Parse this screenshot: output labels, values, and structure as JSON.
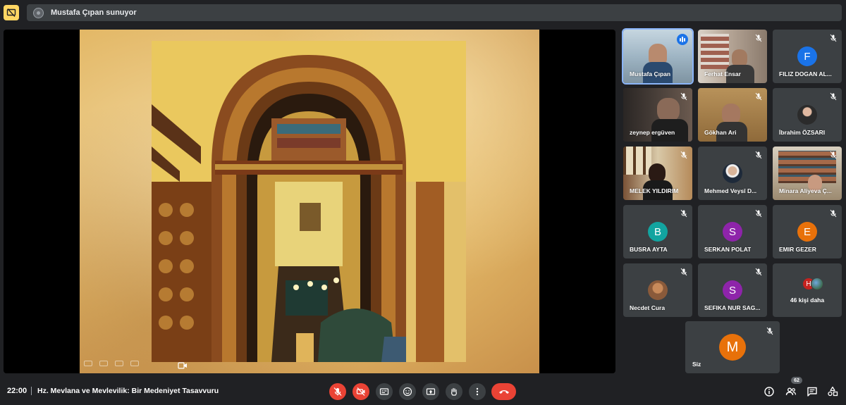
{
  "top": {
    "presenting_text": "Mustafa Çıpan sunuyor"
  },
  "tiles": [
    {
      "name": "Mustafa Çıpan",
      "type": "video",
      "speaking": true
    },
    {
      "name": "Ferhat Ensar",
      "type": "video",
      "muted": true
    },
    {
      "name": "FILIZ DOGAN AL...",
      "type": "avatar",
      "letter": "F",
      "color": "#1a73e8",
      "muted": true
    },
    {
      "name": "zeynep ergüven",
      "type": "video",
      "muted": true
    },
    {
      "name": "Gökhan Ari",
      "type": "video",
      "muted": true
    },
    {
      "name": "İbrahim ÖZSARI",
      "type": "photo",
      "muted": true
    },
    {
      "name": "MELEK YILDIRIM",
      "type": "video",
      "muted": true
    },
    {
      "name": "Mehmed Veysî D...",
      "type": "photo",
      "muted": true
    },
    {
      "name": "Minara Aliyeva Ç...",
      "type": "video",
      "muted": true
    },
    {
      "name": "BUSRA AYTA",
      "type": "avatar",
      "letter": "B",
      "color": "#12a4a0",
      "muted": true
    },
    {
      "name": "SERKAN POLAT",
      "type": "avatar",
      "letter": "S",
      "color": "#8e24aa",
      "muted": true
    },
    {
      "name": "EMIR GEZER",
      "type": "avatar",
      "letter": "E",
      "color": "#e8710a",
      "muted": true
    },
    {
      "name": "Necdet Cura",
      "type": "photo",
      "muted": true
    },
    {
      "name": "SEFIKA NUR SAG...",
      "type": "avatar",
      "letter": "S",
      "color": "#8e24aa",
      "muted": true
    }
  ],
  "more": {
    "label": "46 kişi daha",
    "letter": "H"
  },
  "self": {
    "name": "Siz",
    "letter": "M",
    "color": "#e8710a"
  },
  "bottom": {
    "time": "22:00",
    "title": "Hz. Mevlana ve Mevlevilik: Bir Medeniyet Tasavvuru",
    "participants_count": "62"
  },
  "icons": {
    "present": "present-off-icon",
    "mic": "mic-off-icon",
    "camera": "camera-off-icon",
    "captions": "captions-icon",
    "emoji": "emoji-icon",
    "present_now": "present-now-icon",
    "raise_hand": "raise-hand-icon",
    "more": "more-options-icon",
    "hangup": "hangup-icon",
    "info": "info-icon",
    "people": "people-icon",
    "chat": "chat-icon",
    "activities": "activities-icon"
  }
}
